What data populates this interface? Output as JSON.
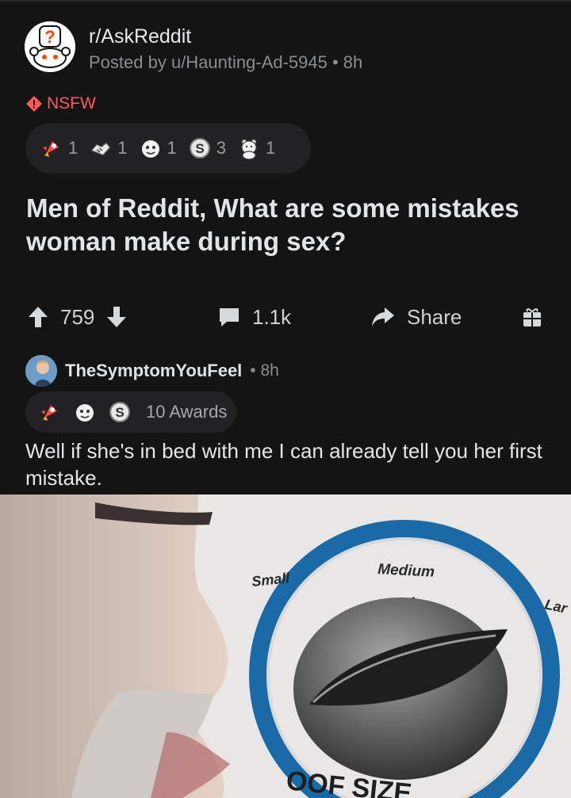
{
  "post": {
    "subreddit": "r/AskReddit",
    "posted_by": "Posted by u/Haunting-Ad-5945 • 8h",
    "nsfw_label": "NSFW",
    "awards": [
      {
        "icon": "rocket-like-award-icon",
        "count": "1"
      },
      {
        "icon": "handshake-award-icon",
        "count": "1"
      },
      {
        "icon": "face-award-icon",
        "count": "1"
      },
      {
        "icon": "silver-award-icon",
        "count": "3"
      },
      {
        "icon": "bear-award-icon",
        "count": "1"
      }
    ],
    "title": "Men of Reddit, What are some mistakes woman make during sex?",
    "votes": "759",
    "comments": "1.1k",
    "share_label": "Share"
  },
  "comment": {
    "username": "TheSymptomYouFeel",
    "time": "• 8h",
    "awards_count": "10 Awards",
    "body": "Well if she's in bed with me I can already tell you her first mistake."
  },
  "meme": {
    "label_small": "Small",
    "label_medium": "Medium",
    "label_large": "Lar",
    "caption": "OOF SIZE"
  },
  "colors": {
    "background": "#141415",
    "nsfw": "#ff585b",
    "award_pill": "#222224",
    "dial_ring": "#1a6aa8"
  }
}
